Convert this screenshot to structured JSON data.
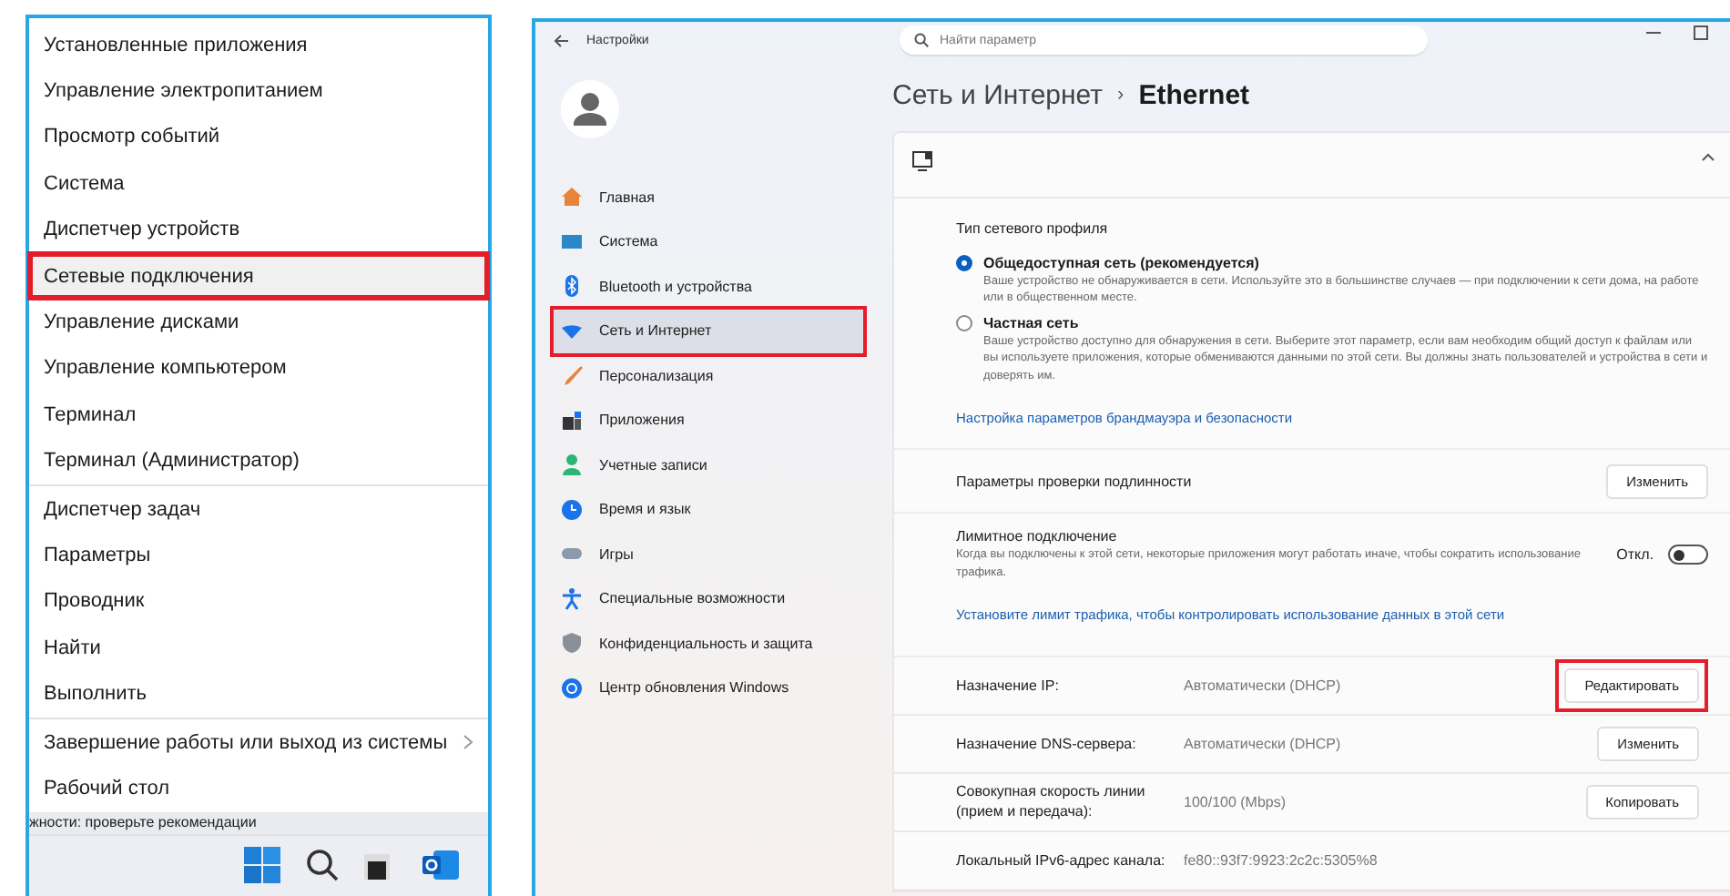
{
  "context_menu": {
    "groups": [
      [
        {
          "label": "Установленные приложения",
          "selected": false,
          "highlighted": false,
          "submenu": false
        },
        {
          "label": "Управление электропитанием",
          "selected": false,
          "highlighted": false,
          "submenu": false
        },
        {
          "label": "Просмотр событий",
          "selected": false,
          "highlighted": false,
          "submenu": false
        },
        {
          "label": "Система",
          "selected": false,
          "highlighted": false,
          "submenu": false
        },
        {
          "label": "Диспетчер устройств",
          "selected": false,
          "highlighted": false,
          "submenu": false
        },
        {
          "label": "Сетевые подключения",
          "selected": true,
          "highlighted": true,
          "submenu": false
        },
        {
          "label": "Управление дисками",
          "selected": false,
          "highlighted": false,
          "submenu": false
        },
        {
          "label": "Управление компьютером",
          "selected": false,
          "highlighted": false,
          "submenu": false
        },
        {
          "label": "Терминал",
          "selected": false,
          "highlighted": false,
          "submenu": false
        },
        {
          "label": "Терминал (Администратор)",
          "selected": false,
          "highlighted": false,
          "submenu": false
        }
      ],
      [
        {
          "label": "Диспетчер задач",
          "selected": false,
          "highlighted": false,
          "submenu": false
        },
        {
          "label": "Параметры",
          "selected": false,
          "highlighted": false,
          "submenu": false
        },
        {
          "label": "Проводник",
          "selected": false,
          "highlighted": false,
          "submenu": false
        },
        {
          "label": "Найти",
          "selected": false,
          "highlighted": false,
          "submenu": false
        },
        {
          "label": "Выполнить",
          "selected": false,
          "highlighted": false,
          "submenu": false
        }
      ],
      [
        {
          "label": "Завершение работы или выход из системы",
          "selected": false,
          "highlighted": false,
          "submenu": true
        },
        {
          "label": "Рабочий стол",
          "selected": false,
          "highlighted": false,
          "submenu": false
        }
      ]
    ]
  },
  "background_text": "жности: проверьте рекомендации",
  "settings": {
    "title": "Настройки",
    "search": {
      "placeholder": "Найти параметр"
    },
    "nav": [
      {
        "label": "Главная",
        "selected": false,
        "highlighted": false
      },
      {
        "label": "Система",
        "selected": false,
        "highlighted": false
      },
      {
        "label": "Bluetooth и устройства",
        "selected": false,
        "highlighted": false
      },
      {
        "label": "Сеть и Интернет",
        "selected": true,
        "highlighted": true
      },
      {
        "label": "Персонализация",
        "selected": false,
        "highlighted": false
      },
      {
        "label": "Приложения",
        "selected": false,
        "highlighted": false
      },
      {
        "label": "Учетные записи",
        "selected": false,
        "highlighted": false
      },
      {
        "label": "Время и язык",
        "selected": false,
        "highlighted": false
      },
      {
        "label": "Игры",
        "selected": false,
        "highlighted": false
      },
      {
        "label": "Специальные возможности",
        "selected": false,
        "highlighted": false
      },
      {
        "label": "Конфиденциальность и защита",
        "selected": false,
        "highlighted": false
      },
      {
        "label": "Центр обновления Windows",
        "selected": false,
        "highlighted": false
      }
    ],
    "breadcrumb": {
      "parent": "Сеть и Интернет",
      "separator": "›",
      "current": "Ethernet"
    },
    "profile": {
      "title": "Тип сетевого профиля",
      "options": [
        {
          "label": "Общедоступная сеть (рекомендуется)",
          "description": "Ваше устройство не обнаруживается в сети. Используйте это в большинстве случаев — при подключении к сети дома, на работе или в общественном месте.",
          "selected": true
        },
        {
          "label": "Частная сеть",
          "description": "Ваше устройство доступно для обнаружения в сети. Выберите этот параметр, если вам необходим общий доступ к файлам или вы используете приложения, которые обмениваются данными по этой сети. Вы должны знать пользователей и устройства в сети и доверять им.",
          "selected": false
        }
      ],
      "link": "Настройка параметров брандмауэра и безопасности"
    },
    "auth": {
      "label": "Параметры проверки подлинности",
      "button": "Изменить"
    },
    "metered": {
      "label": "Лимитное подключение",
      "description": "Когда вы подключены к этой сети, некоторые приложения могут работать иначе, чтобы сократить использование трафика.",
      "state_text": "Откл.",
      "on": false,
      "link": "Установите лимит трафика, чтобы контролировать использование данных в этой сети"
    },
    "properties": [
      {
        "label": "Назначение IP:",
        "value": "Автоматически (DHCP)",
        "button": "Редактировать",
        "highlighted": true
      },
      {
        "label": "Назначение DNS-сервера:",
        "value": "Автоматически (DHCP)",
        "button": "Изменить",
        "highlighted": false
      },
      {
        "label": "Совокупная скорость линии (прием и передача):",
        "value": "100/100 (Mbps)",
        "button": "Копировать",
        "highlighted": false
      },
      {
        "label": "Локальный IPv6-адрес канала:",
        "value": "fe80::93f7:9923:2c2c:5305%8"
      }
    ]
  }
}
